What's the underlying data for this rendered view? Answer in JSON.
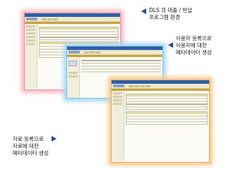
{
  "callouts": {
    "top": {
      "line1": "DLS 의 대출 / 반납",
      "line2": "프로그램 환경"
    },
    "right": {
      "line1": "이용자 등록으로",
      "line2": "이용자에 대한",
      "line3": "메타데이터 생성"
    },
    "left": {
      "line1": "자료 등록으로",
      "line2": "자료에 대한",
      "line3": "메타데이터 생성"
    }
  },
  "colors": {
    "accent": "#1f4f9c",
    "glow_pink": "#f6b7c1",
    "glow_blue": "#a9d6f3",
    "glow_orange": "#f7c98e"
  },
  "icons": {
    "arrow_callout": "blue-triangle-arrow"
  }
}
